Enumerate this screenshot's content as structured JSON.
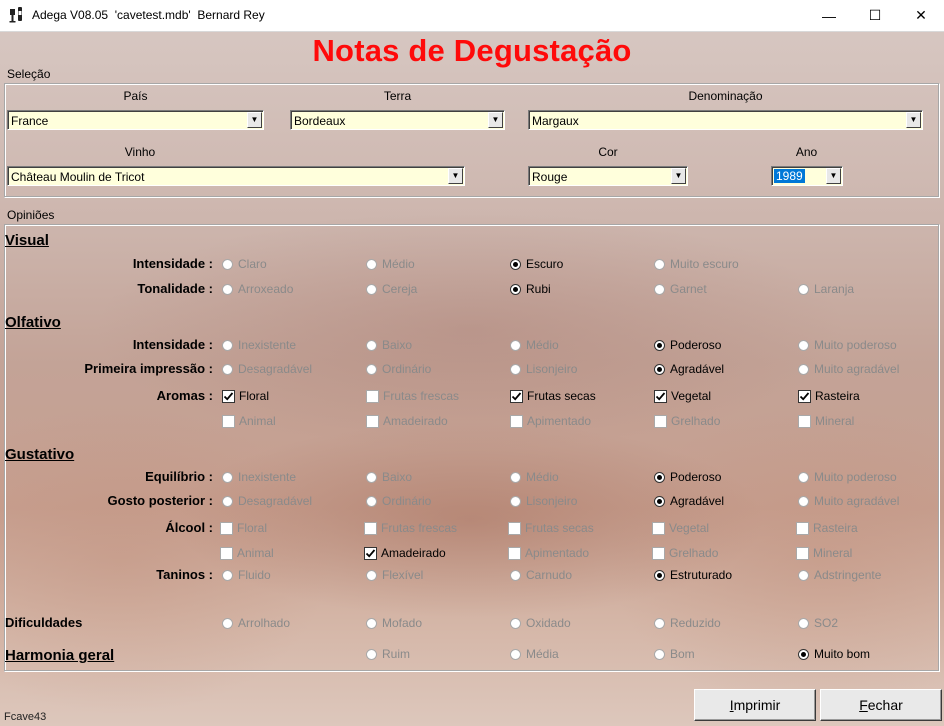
{
  "window": {
    "title": "Adega V08.05  'cavetest.mdb'  Bernard Rey"
  },
  "page_title": "Notas de Degustação",
  "selecao": {
    "group_label": "Seleção",
    "pais": {
      "label": "País",
      "value": "France"
    },
    "terra": {
      "label": "Terra",
      "value": "Bordeaux"
    },
    "denominacao": {
      "label": "Denominação",
      "value": "Margaux"
    },
    "vinho": {
      "label": "Vinho",
      "value": "Château Moulin de Tricot"
    },
    "cor": {
      "label": "Cor",
      "value": "Rouge"
    },
    "ano": {
      "label": "Ano",
      "value": "1989"
    }
  },
  "opinioes": {
    "group_label": "Opiniões",
    "sections": {
      "visual": "Visual",
      "olfativo": "Olfativo",
      "gustativo": "Gustativo",
      "harmonia": "Harmonia geral"
    },
    "rows": {
      "v_intensidade": {
        "label": "Intensidade :",
        "options": [
          "Claro",
          "Médio",
          "Escuro",
          "Muito escuro"
        ]
      },
      "v_tonalidade": {
        "label": "Tonalidade :",
        "options": [
          "Arroxeado",
          "Cereja",
          "Rubi",
          "Garnet",
          "Laranja"
        ]
      },
      "o_intensidade": {
        "label": "Intensidade :",
        "options": [
          "Inexistente",
          "Baixo",
          "Médio",
          "Poderoso",
          "Muito poderoso"
        ]
      },
      "o_primeira": {
        "label": "Primeira impressão :",
        "options": [
          "Desagradável",
          "Ordinário",
          "Lisonjeiro",
          "Agradável",
          "Muito agradável"
        ]
      },
      "o_aromas": {
        "label": "Aromas :",
        "options": [
          "Floral",
          "Frutas frescas",
          "Frutas secas",
          "Vegetal",
          "Rasteira"
        ]
      },
      "o_aromas2": {
        "options": [
          "Animal",
          "Amadeirado",
          "Apimentado",
          "Grelhado",
          "Mineral"
        ]
      },
      "g_equilibrio": {
        "label": "Equilíbrio :",
        "options": [
          "Inexistente",
          "Baixo",
          "Médio",
          "Poderoso",
          "Muito poderoso"
        ]
      },
      "g_gosto": {
        "label": "Gosto posterior :",
        "options": [
          "Desagradável",
          "Ordinário",
          "Lisonjeiro",
          "Agradável",
          "Muito agradável"
        ]
      },
      "g_alcool": {
        "label": "Álcool :",
        "options": [
          "Floral",
          "Frutas frescas",
          "Frutas secas",
          "Vegetal",
          "Rasteira"
        ]
      },
      "g_alcool2": {
        "options": [
          "Animal",
          "Amadeirado",
          "Apimentado",
          "Grelhado",
          "Mineral"
        ]
      },
      "g_taninos": {
        "label": "Taninos :",
        "options": [
          "Fluido",
          "Flexível",
          "Carnudo",
          "Estruturado",
          "Adstringente"
        ]
      },
      "dificuldades": {
        "label": "Dificuldades",
        "options": [
          "Arrolhado",
          "Mofado",
          "Oxidado",
          "Reduzido",
          "SO2"
        ]
      },
      "harmonia": {
        "options": [
          "Ruim",
          "Média",
          "Bom",
          "Muito bom"
        ]
      }
    }
  },
  "buttons": {
    "imprimir": "Imprimir",
    "fechar": "Fechar"
  },
  "footer": "Fcave43"
}
